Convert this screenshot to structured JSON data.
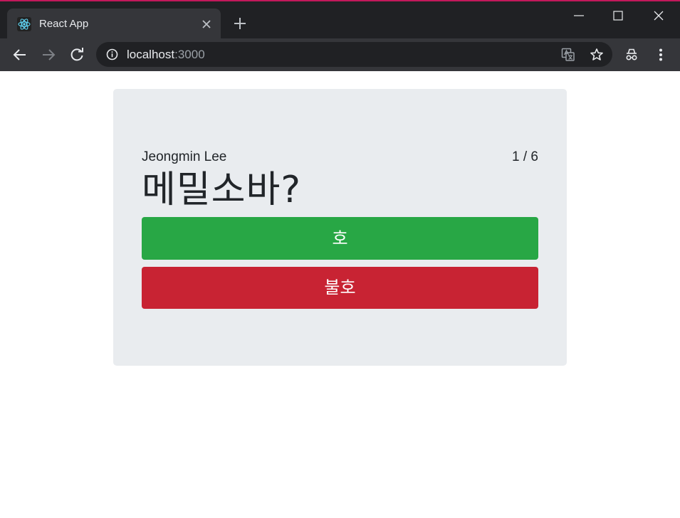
{
  "browser": {
    "tab": {
      "title": "React App",
      "favicon": "react-logo-icon"
    },
    "address": {
      "host": "localhost",
      "port": ":3000"
    },
    "icons": [
      "back-icon",
      "forward-icon",
      "reload-icon",
      "info-icon",
      "translate-icon",
      "star-icon",
      "incognito-icon",
      "menu-icon",
      "minimize-icon",
      "maximize-icon",
      "close-icon",
      "new-tab-icon"
    ],
    "accent_color": "#c2185b"
  },
  "card": {
    "author": "Jeongmin Lee",
    "counter": "1 / 6",
    "question": "메밀소바?",
    "like_label": "호",
    "dislike_label": "불호",
    "colors": {
      "like": "#28a745",
      "dislike": "#c82333",
      "background": "#e9ecef"
    }
  }
}
